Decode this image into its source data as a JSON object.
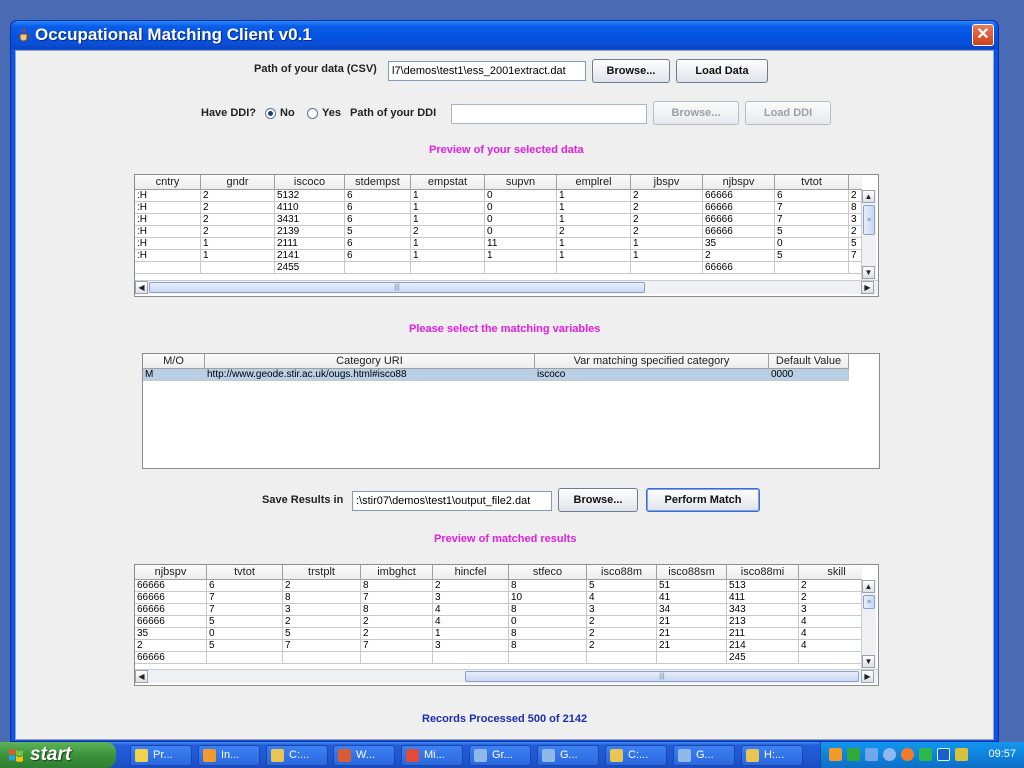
{
  "window": {
    "title": "Occupational Matching Client v0.1",
    "close_glyph": "✕"
  },
  "data_path": {
    "label": "Path of your data (CSV)",
    "value": "l7\\demos\\test1\\ess_2001extract.dat",
    "browse": "Browse...",
    "load": "Load Data"
  },
  "ddi": {
    "label": "Have DDI?",
    "no": "No",
    "yes": "Yes",
    "selected": "No",
    "path_label": "Path of your DDI",
    "path_value": "",
    "browse": "Browse...",
    "load": "Load DDI"
  },
  "preview_data": {
    "heading": "Preview of your selected data",
    "columns": [
      "cntry",
      "gndr",
      "iscoco",
      "stdempst",
      "empstat",
      "supvn",
      "emplrel",
      "jbspv",
      "njbspv",
      "tvtot",
      ""
    ],
    "rows": [
      [
        ":H",
        "2",
        "5132",
        "6",
        "1",
        "0",
        "1",
        "2",
        "66666",
        "6",
        "2"
      ],
      [
        ":H",
        "2",
        "4110",
        "6",
        "1",
        "0",
        "1",
        "2",
        "66666",
        "7",
        "8"
      ],
      [
        ":H",
        "2",
        "3431",
        "6",
        "1",
        "0",
        "1",
        "2",
        "66666",
        "7",
        "3"
      ],
      [
        ":H",
        "2",
        "2139",
        "5",
        "2",
        "0",
        "2",
        "2",
        "66666",
        "5",
        "2"
      ],
      [
        ":H",
        "1",
        "2111",
        "6",
        "1",
        "11",
        "1",
        "1",
        "35",
        "0",
        "5"
      ],
      [
        ":H",
        "1",
        "2141",
        "6",
        "1",
        "1",
        "1",
        "1",
        "2",
        "5",
        "7"
      ],
      [
        "",
        "",
        "2455",
        "",
        "",
        "",
        "",
        "",
        "66666",
        "",
        ""
      ]
    ]
  },
  "matching": {
    "heading": "Please select the matching variables",
    "columns": [
      "M/O",
      "Category URI",
      "Var matching specified category",
      "Default Value"
    ],
    "rows": [
      [
        "M",
        "http://www.geode.stir.ac.uk/ougs.html#isco88",
        "iscoco",
        "0000"
      ]
    ]
  },
  "save": {
    "label": "Save Results in",
    "value": ":\\stir07\\demos\\test1\\output_file2.dat",
    "browse": "Browse...",
    "perform": "Perform Match"
  },
  "preview_results": {
    "heading": "Preview of matched results",
    "columns": [
      "njbspv",
      "tvtot",
      "trstplt",
      "imbghct",
      "hincfel",
      "stfeco",
      "isco88m",
      "isco88sm",
      "isco88mi",
      "skill"
    ],
    "rows": [
      [
        "66666",
        "6",
        "2",
        "8",
        "2",
        "8",
        "5",
        "51",
        "513",
        "2"
      ],
      [
        "66666",
        "7",
        "8",
        "7",
        "3",
        "10",
        "4",
        "41",
        "411",
        "2"
      ],
      [
        "66666",
        "7",
        "3",
        "8",
        "4",
        "8",
        "3",
        "34",
        "343",
        "3"
      ],
      [
        "66666",
        "5",
        "2",
        "2",
        "4",
        "0",
        "2",
        "21",
        "213",
        "4"
      ],
      [
        "35",
        "0",
        "5",
        "2",
        "1",
        "8",
        "2",
        "21",
        "211",
        "4"
      ],
      [
        "2",
        "5",
        "7",
        "7",
        "3",
        "8",
        "2",
        "21",
        "214",
        "4"
      ],
      [
        "66666",
        "",
        "",
        "",
        "",
        "",
        "",
        "",
        "245",
        ""
      ]
    ]
  },
  "status": "Records Processed 500 of 2142",
  "taskbar": {
    "start": "start",
    "items": [
      "Pr...",
      "In...",
      "C:...",
      "W...",
      "Mi...",
      "Gr...",
      "G...",
      "C:...",
      "G...",
      "H:..."
    ],
    "clock": "09:57"
  },
  "colors": {
    "heading": "#e020e0",
    "status": "#1a2db0",
    "selection": "#b9cfe6"
  }
}
